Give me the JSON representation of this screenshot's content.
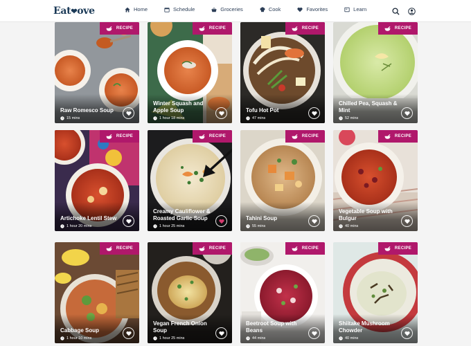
{
  "brand": {
    "name_left": "Eat",
    "name_heart": "❤",
    "name_right": "ove"
  },
  "nav": [
    {
      "label": "Home",
      "icon": "home-icon"
    },
    {
      "label": "Schedule",
      "icon": "calendar-icon"
    },
    {
      "label": "Groceries",
      "icon": "basket-icon"
    },
    {
      "label": "Cook",
      "icon": "chef-hat-icon"
    },
    {
      "label": "Favorites",
      "icon": "heart-icon"
    },
    {
      "label": "Learn",
      "icon": "book-icon"
    }
  ],
  "badge_label": "RECIPE",
  "cards": [
    {
      "title": "Raw Romesco Soup",
      "time": "15 mins"
    },
    {
      "title": "Winter Squash and Apple Soup",
      "time": "1 hour 18 mins"
    },
    {
      "title": "Tofu Hot Pot",
      "time": "47 mins"
    },
    {
      "title": "Chilled Pea, Squash & Mint",
      "time": "52 mins"
    },
    {
      "title": "Artichoke Lentil Stew",
      "time": "1 hour 20 mins"
    },
    {
      "title": "Creamy Cauliflower & Roasted Garlic Soup",
      "time": "1 hour 25 mins"
    },
    {
      "title": "Tahini Soup",
      "time": "55 mins"
    },
    {
      "title": "Vegetable Soup with Bulgur",
      "time": "40 mins"
    },
    {
      "title": "Cabbage Soup",
      "time": "1 hour 10 mins"
    },
    {
      "title": "Vegan French Onion Soup",
      "time": "1 hour 25 mins"
    },
    {
      "title": "Beetroot Soup with Beans",
      "time": "44 mins"
    },
    {
      "title": "Shiitake Mushroom Chowder",
      "time": "40 mins"
    }
  ],
  "colors": {
    "accent": "#b0186b",
    "nav_text": "#2c3e57"
  }
}
